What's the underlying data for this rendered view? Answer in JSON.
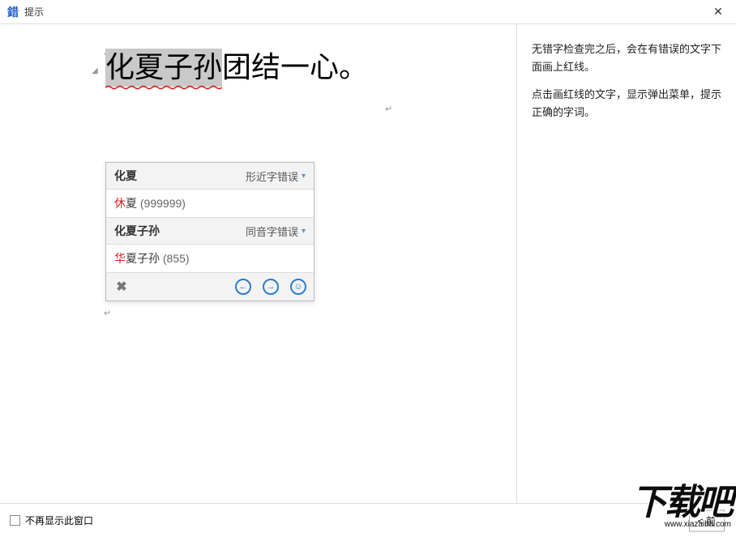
{
  "window": {
    "icon_char": "錯",
    "title": "提示",
    "close_label": "✕"
  },
  "document": {
    "highlighted_text": "化夏子孙",
    "rest_text": "团结一心。"
  },
  "popup": {
    "sections": [
      {
        "word": "化夏",
        "type": "形近字错误",
        "option_corr": "休",
        "option_rest": "夏",
        "option_freq": "(999999)"
      },
      {
        "word": "化夏子孙",
        "type": "同音字错误",
        "option_corr": "华",
        "option_rest": "夏子孙",
        "option_freq": "(855)"
      }
    ],
    "toolbar": {
      "close": "✖",
      "prev": "←",
      "next": "→",
      "smile": "☺"
    }
  },
  "help": {
    "para1": "无错字检查完之后，会在有错误的文字下面画上红线。",
    "para2": "点击画红线的文字，显示弹出菜单，提示正确的字词。"
  },
  "footer": {
    "checkbox_label": "不再显示此窗口",
    "button_label": "< 前"
  },
  "watermark": {
    "big": "下载吧",
    "url": "www.xiazaiba.com"
  }
}
